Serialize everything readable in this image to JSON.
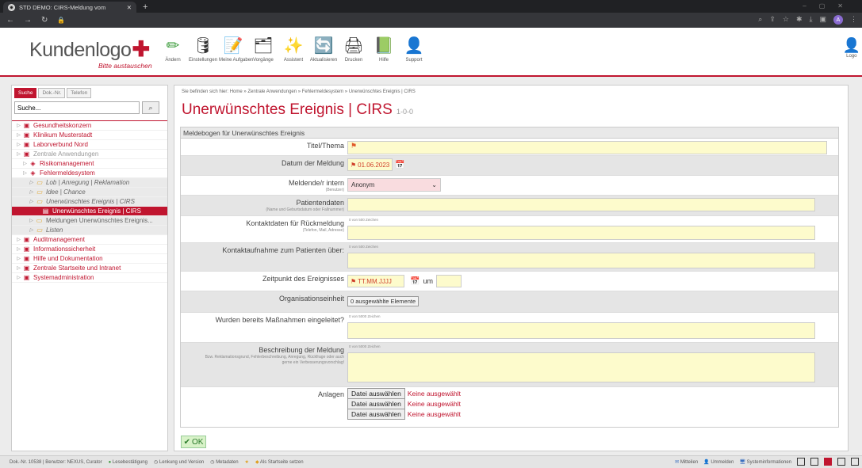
{
  "browser": {
    "tab_title": "STD DEMO: CIRS-Meldung vom",
    "new_tab": "+"
  },
  "logo": {
    "text": "Kundenlogo",
    "sub": "Bitte austauschen"
  },
  "toolbar": [
    {
      "label": "Ändern",
      "icon": "✏"
    },
    {
      "label": "Einstellungen",
      "icon": "🛢"
    },
    {
      "label": "Meine Aufgaben",
      "icon": "📝"
    },
    {
      "label": "Vorgänge",
      "icon": "🗂"
    },
    {
      "label": "Assistent",
      "icon": "✨"
    },
    {
      "label": "Aktualisieren",
      "icon": "🔄"
    },
    {
      "label": "Drucken",
      "icon": "🖨"
    },
    {
      "label": "Hilfe",
      "icon": "📗"
    },
    {
      "label": "Support",
      "icon": "👤"
    }
  ],
  "logout_label": "Logo",
  "sidebar": {
    "tabs": [
      "Suche",
      "Dok.-Nr.",
      "Telefon"
    ],
    "search_value": "Suche...",
    "tree": [
      {
        "label": "Gesundheitskonzern",
        "cls": "",
        "ind": 0
      },
      {
        "label": "Klinikum Musterstadt",
        "cls": "",
        "ind": 0
      },
      {
        "label": "Laborverbund Nord",
        "cls": "",
        "ind": 0
      },
      {
        "label": "Zentrale Anwendungen",
        "cls": "grey",
        "ind": 0
      },
      {
        "label": "Risikomanagement",
        "cls": "",
        "ind": 1
      },
      {
        "label": "Fehlermeldesystem",
        "cls": "",
        "ind": 1
      },
      {
        "label": "Lob | Anregung | Reklamation",
        "cls": "bg it",
        "ind": 2
      },
      {
        "label": "Idee | Chance",
        "cls": "bg it",
        "ind": 2
      },
      {
        "label": "Unerwünschtes Ereignis | CIRS",
        "cls": "bg it",
        "ind": 2
      },
      {
        "label": "Unerwünschtes Ereignis | CIRS",
        "cls": "sel",
        "ind": 3
      },
      {
        "label": "Meldungen Unerwünschtes Ereignis...",
        "cls": "bg",
        "ind": 2
      },
      {
        "label": "Listen",
        "cls": "bg it",
        "ind": 2
      },
      {
        "label": "Auditmanagement",
        "cls": "",
        "ind": 0
      },
      {
        "label": "Informationssicherheit",
        "cls": "",
        "ind": 0
      },
      {
        "label": "Hilfe und Dokumentation",
        "cls": "",
        "ind": 0
      },
      {
        "label": "Zentrale Startseite und Intranet",
        "cls": "",
        "ind": 0
      },
      {
        "label": "Systemadministration",
        "cls": "",
        "ind": 0
      }
    ]
  },
  "main": {
    "breadcrumb": "Sie befinden sich hier: Home » Zentrale Anwendungen » Fehlermeldesystem » Unerwünschtes Ereignis | CIRS",
    "title": "Unerwünschtes Ereignis | CIRS",
    "version": "1-0-0",
    "form_header": "Meldebogen für Unerwünschtes Ereignis",
    "fields": {
      "titel": "Titel/Thema",
      "datum": "Datum der Meldung",
      "datum_value": "01.06.2023",
      "meldende": "Meldende/r intern",
      "meldende_sub": "(Benutzer)",
      "meldende_value": "Anonym",
      "patient": "Patientendaten",
      "patient_sub": "(Name und Geburtsdatum oder Fallnummer)",
      "kontakt": "Kontaktdaten für Rückmeldung",
      "kontakt_sub": "(Telefon, Mail, Adresse)",
      "kontakt_count": "0 von 500 Zeichen",
      "kontaktaufnahme": "Kontaktaufnahme zum Patienten über:",
      "kontaktaufnahme_count": "0 von 500 Zeichen",
      "zeitpunkt": "Zeitpunkt des Ereignisses",
      "zeitpunkt_placeholder": "TT.MM.JJJJ",
      "um": "um",
      "org": "Organisationseinheit",
      "org_btn": "0 ausgewählte Elemente",
      "massnahmen": "Wurden bereits Maßnahmen eingeleitet?",
      "massnahmen_count": "0 von 5000 Zeichen",
      "beschreibung": "Beschreibung der Meldung",
      "beschreibung_sub": "Bzw. Reklamationsgrund, Fehlerbeschreibung, Anregung, Rückfrage oder auch gerne ein Verbesserungsvorschlag!",
      "beschreibung_count": "0 von 5000 Zeichen",
      "anlagen": "Anlagen",
      "file_btn": "Datei auswählen",
      "no_file": "Keine ausgewählt"
    },
    "ok": "OK"
  },
  "status": {
    "left": [
      "Dok.-Nr. 10538 | Benutzer: NEXUS, Curator",
      "Lesebestätigung",
      "Lenkung und Version",
      "Metadaten",
      "",
      "Als Startseite setzen"
    ],
    "right": [
      "Mitteilen",
      "Ummelden",
      "Systeminformationen"
    ]
  }
}
